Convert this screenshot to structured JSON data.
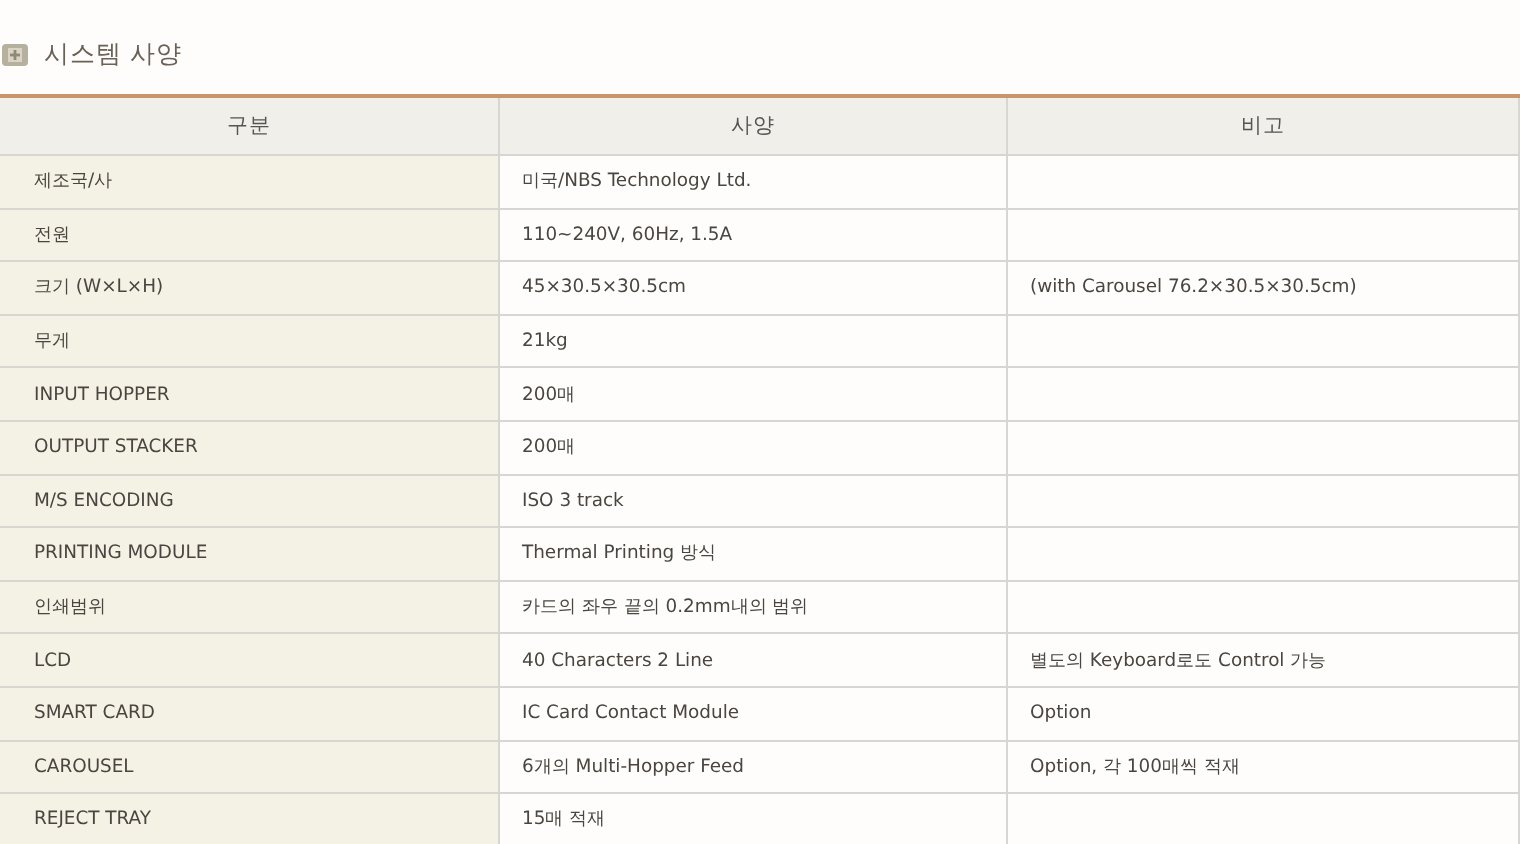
{
  "section_title": "시스템 사양",
  "table": {
    "columns": [
      "구분",
      "사양",
      "비고"
    ],
    "rows": [
      {
        "cells": [
          "제조국/사",
          "미국/NBS Technology Ltd.",
          ""
        ]
      },
      {
        "cells": [
          "전원",
          "110~240V, 60Hz, 1.5A",
          ""
        ]
      },
      {
        "cells": [
          "크기 (W×L×H)",
          "45×30.5×30.5cm",
          "(with Carousel 76.2×30.5×30.5cm)"
        ]
      },
      {
        "cells": [
          "무게",
          "21kg",
          ""
        ]
      },
      {
        "cells": [
          "INPUT HOPPER",
          "200매",
          ""
        ]
      },
      {
        "cells": [
          "OUTPUT STACKER",
          "200매",
          ""
        ]
      },
      {
        "cells": [
          "M/S ENCODING",
          "ISO 3 track",
          ""
        ]
      },
      {
        "cells": [
          "PRINTING MODULE",
          "Thermal Printing 방식",
          ""
        ]
      },
      {
        "cells": [
          "인쇄범위",
          "카드의 좌우 끝의 0.2mm내의 범위",
          ""
        ]
      },
      {
        "cells": [
          "LCD",
          "40 Characters 2 Line",
          "별도의 Keyboard로도 Control 가능"
        ]
      },
      {
        "cells": [
          "SMART CARD",
          "IC Card Contact Module",
          "Option"
        ]
      },
      {
        "cells": [
          "CAROUSEL",
          "6개의 Multi-Hopper Feed",
          "Option, 각 100매씩 적재"
        ]
      },
      {
        "cells": [
          "REJECT TRAY",
          "15매 적재",
          ""
        ]
      }
    ]
  }
}
